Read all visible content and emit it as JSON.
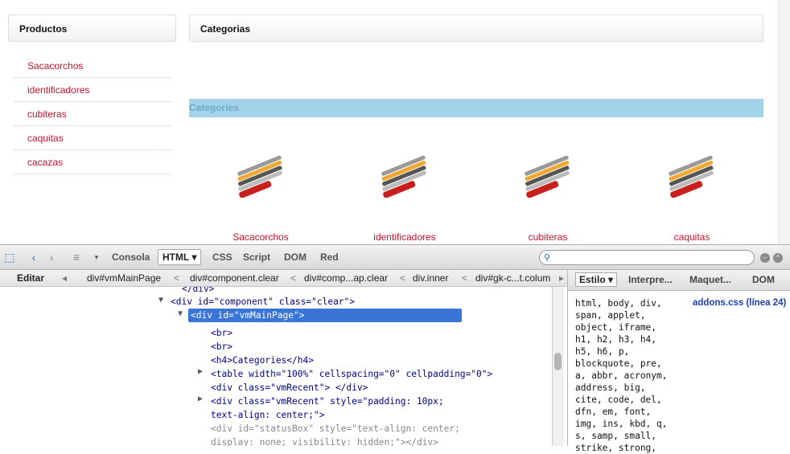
{
  "page": {
    "sidebar_title": "Productos",
    "products": [
      "Sacacorchos",
      "identificadores",
      "cubiteras",
      "caquitas",
      "cacazas"
    ],
    "main_title": "Categorias",
    "categories_heading": "Categories",
    "categories": [
      {
        "label": "Sacacorchos",
        "thumb": "corkscrew-image"
      },
      {
        "label": "identificadores",
        "thumb": "corkscrew-image"
      },
      {
        "label": "cubiteras",
        "thumb": "corkscrew-image"
      },
      {
        "label": "caquitas",
        "thumb": "corkscrew-image"
      }
    ],
    "colors": {
      "link": "#c8102e",
      "band": "#a3d4ea",
      "band_text": "#6fa9c9"
    }
  },
  "firebug": {
    "toolbar": {
      "tabs": [
        "Consola",
        "HTML",
        "CSS",
        "Script",
        "DOM",
        "Red"
      ],
      "active_tab": "HTML",
      "search_placeholder": ""
    },
    "breadcrumbs": {
      "edit": "Editar",
      "items": [
        "div#vmMainPage",
        "div#component.clear",
        "div#comp...ap.clear",
        "div.inner",
        "div#gk-c...t.colum"
      ]
    },
    "html_lines": [
      {
        "text": "</div>"
      },
      {
        "tag": "div",
        "attrs": [
          [
            "id",
            "component"
          ],
          [
            "class",
            "clear"
          ]
        ],
        "text": "<div id=\"component\" class=\"clear\">"
      },
      {
        "text": "<div id=\"vmMainPage\">"
      },
      {
        "text": "<br>"
      },
      {
        "text": "<br>"
      },
      {
        "text": "<h4>Categories</h4>"
      },
      {
        "text": "<table width=\"100%\" cellspacing=\"0\" cellpadding=\"0\">"
      },
      {
        "text": "<div class=\"vmRecent\"> </div>"
      },
      {
        "text": "<div class=\"vmRecent\" style=\"padding: 10px; text-align: center;\">"
      },
      {
        "text": "<div id=\"statusBox\" style=\"text-align: center; display: none; visibility: hidden;\"></div>"
      }
    ],
    "side": {
      "tabs": [
        "Estilo",
        "Interpre...",
        "Maquet...",
        "DOM"
      ],
      "active_tab": "Estilo",
      "selectors": "html, body, div,\nspan, applet,\nobject, iframe,\nh1, h2, h3, h4,\nh5, h6, p,\nblockquote, pre,\na, abbr, acronym,\naddress, big,\ncite, code, del,\ndfn, em, font,\nimg, ins, kbd, q,\ns, samp, small,\nstrike, strong,",
      "source": "addons.css (línea 24)"
    }
  }
}
